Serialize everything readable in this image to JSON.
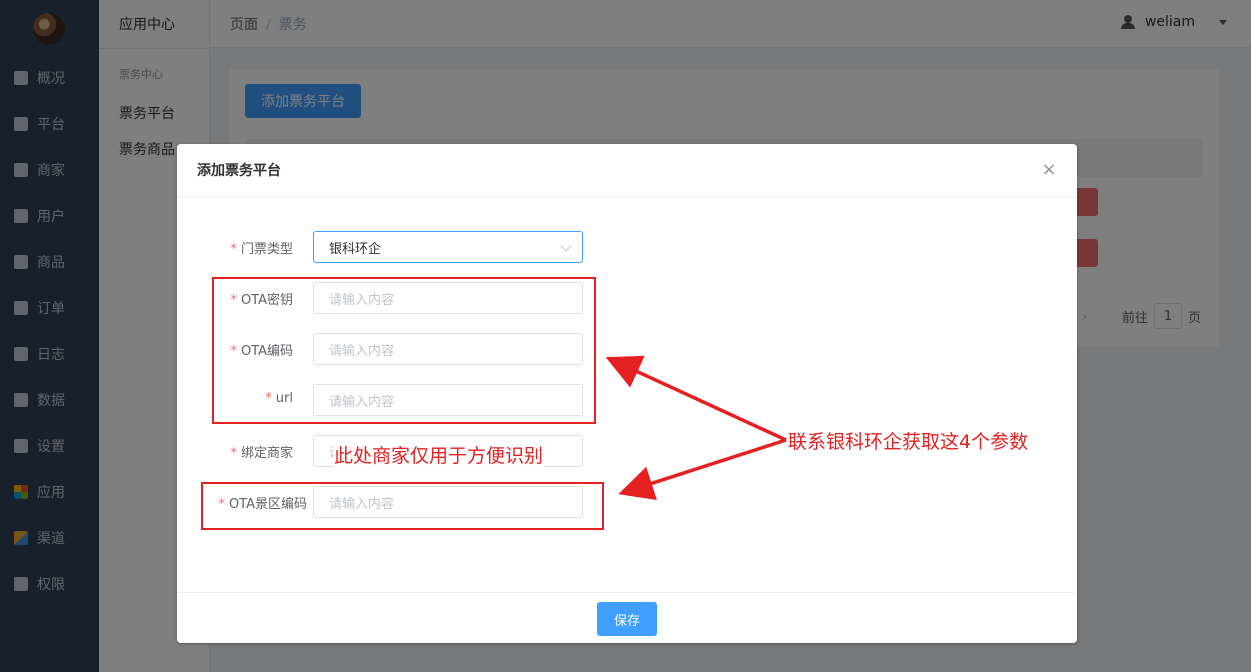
{
  "sidebar": {
    "items": [
      {
        "label": "概况",
        "icon": "dashboard-icon"
      },
      {
        "label": "平台",
        "icon": "monitor-icon"
      },
      {
        "label": "商家",
        "icon": "shop-icon"
      },
      {
        "label": "用户",
        "icon": "user-icon"
      },
      {
        "label": "商品",
        "icon": "goods-icon"
      },
      {
        "label": "订单",
        "icon": "order-icon"
      },
      {
        "label": "日志",
        "icon": "log-icon"
      },
      {
        "label": "数据",
        "icon": "chart-icon"
      },
      {
        "label": "设置",
        "icon": "gear-icon"
      },
      {
        "label": "应用",
        "icon": "apps-icon"
      },
      {
        "label": "渠道",
        "icon": "cube-icon"
      },
      {
        "label": "权限",
        "icon": "lock-icon"
      }
    ]
  },
  "submenu": {
    "title": "应用中心",
    "group": "票务中心",
    "items": [
      "票务平台",
      "票务商品"
    ]
  },
  "header": {
    "breadcrumb_root": "页面",
    "breadcrumb_sep": "/",
    "breadcrumb_current": "票务",
    "username": "weliam"
  },
  "main": {
    "add_button": "添加票务平台",
    "pager_prefix": "前往",
    "pager_page": "1",
    "pager_suffix": "页",
    "pager_next": "›"
  },
  "dialog": {
    "title": "添加票务平台",
    "close": "×",
    "fields": [
      {
        "label": "门票类型",
        "required": true,
        "value": "银科环企",
        "placeholder": ""
      },
      {
        "label": "OTA密钥",
        "required": true,
        "value": "",
        "placeholder": "请输入内容"
      },
      {
        "label": "OTA编码",
        "required": true,
        "value": "",
        "placeholder": "请输入内容"
      },
      {
        "label": "url",
        "required": true,
        "value": "",
        "placeholder": "请输入内容"
      },
      {
        "label": "绑定商家",
        "required": true,
        "value": "",
        "placeholder": "请选择"
      },
      {
        "label": "OTA景区编码",
        "required": true,
        "value": "",
        "placeholder": "请输入内容"
      }
    ],
    "save_button": "保存"
  },
  "annotations": {
    "merchant_note": "此处商家仅用于方便识别",
    "params_note": "联系银科环企获取这4个参数",
    "color": "#e52020"
  }
}
